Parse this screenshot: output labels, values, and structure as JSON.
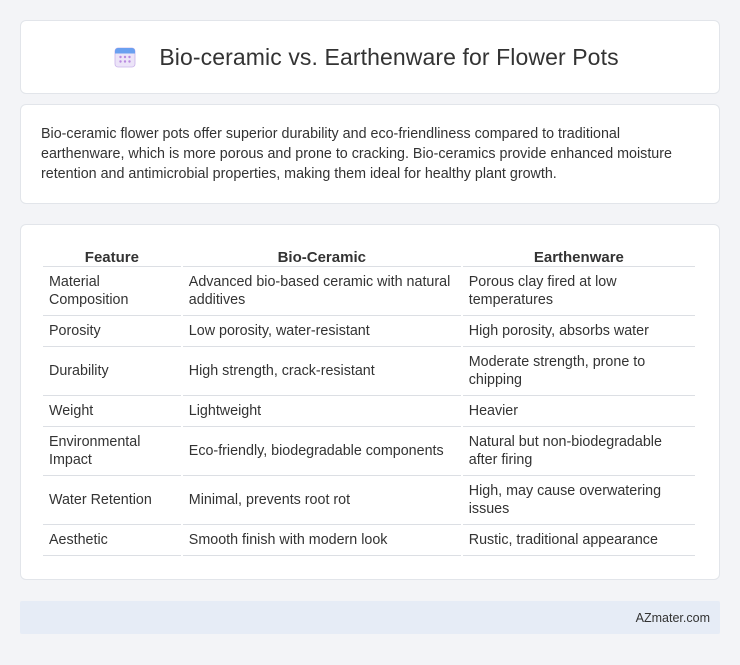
{
  "header": {
    "title": "Bio-ceramic vs. Earthenware for Flower Pots",
    "icon": "calendar-icon"
  },
  "intro": {
    "text": "Bio-ceramic flower pots offer superior durability and eco-friendliness compared to traditional earthenware, which is more porous and prone to cracking. Bio-ceramics provide enhanced moisture retention and antimicrobial properties, making them ideal for healthy plant growth."
  },
  "table": {
    "headers": [
      "Feature",
      "Bio-Ceramic",
      "Earthenware"
    ],
    "rows": [
      [
        "Material Composition",
        "Advanced bio-based ceramic with natural additives",
        "Porous clay fired at low temperatures"
      ],
      [
        "Porosity",
        "Low porosity, water-resistant",
        "High porosity, absorbs water"
      ],
      [
        "Durability",
        "High strength, crack-resistant",
        "Moderate strength, prone to chipping"
      ],
      [
        "Weight",
        "Lightweight",
        "Heavier"
      ],
      [
        "Environmental Impact",
        "Eco-friendly, biodegradable components",
        "Natural but non-biodegradable after firing"
      ],
      [
        "Water Retention",
        "Minimal, prevents root rot",
        "High, may cause overwatering issues"
      ],
      [
        "Aesthetic",
        "Smooth finish with modern look",
        "Rustic, traditional appearance"
      ]
    ]
  },
  "footer": {
    "text": "AZmater.com"
  },
  "colors": {
    "background": "#f3f4f7",
    "card": "#ffffff",
    "footer": "#e6ecf6",
    "icon_top": "#6aa0f0",
    "icon_body": "#ece4f8",
    "icon_dots": "#b98ae0"
  }
}
